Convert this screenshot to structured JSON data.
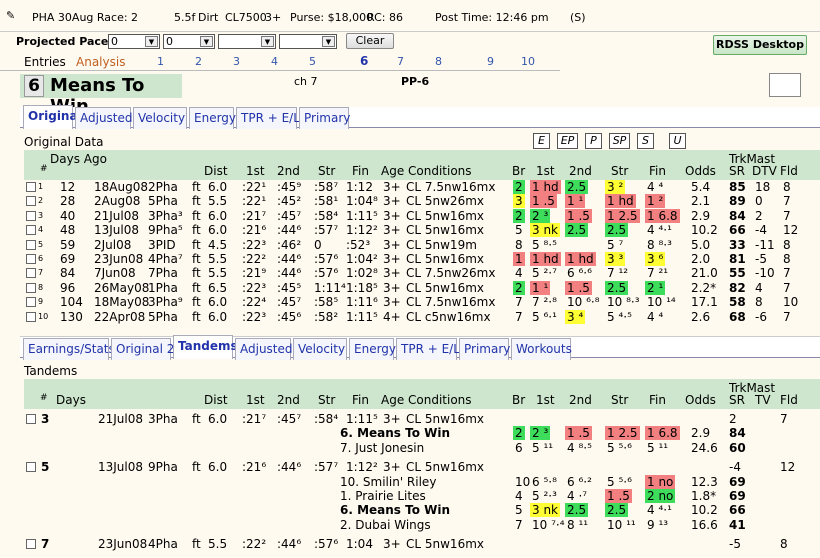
{
  "header": {
    "race": "PHA 30Aug Race: 2",
    "dist": "5.5f",
    "surface": "Dirt",
    "class": "CL7500",
    "flag": "3+",
    "purse": "Purse: $18,000",
    "rc": "RC: 86",
    "post": "Post Time: 12:46 pm",
    "s": "(S)"
  },
  "pace": {
    "label": "Projected Pace:",
    "v1": "0",
    "v2": "0",
    "v3": "",
    "v4": "",
    "clear": "Clear",
    "rdss": "RDSS Desktop"
  },
  "top_tabs": {
    "entries": "Entries",
    "analysis": "Analysis",
    "nums": [
      "1",
      "2",
      "3",
      "4",
      "5",
      "6",
      "7",
      "8",
      "9",
      "10"
    ]
  },
  "horse": {
    "num": "6",
    "name": "Means To Win",
    "sex": "ch 7",
    "pp": "PP-6"
  },
  "tabs_a": [
    "Original",
    "Adjusted",
    "Velocity",
    "Energy",
    "TPR + E/L",
    "Primary"
  ],
  "section_a": "Original Data",
  "view_buttons": [
    "E",
    "EP",
    "P",
    "SP",
    "S",
    "U"
  ],
  "hdr_a": {
    "days_ago": "Days Ago",
    "num": "#",
    "dist": "Dist",
    "c1": "1st",
    "c2": "2nd",
    "str": "Str",
    "fin": "Fin",
    "age": "Age",
    "cond": "Conditions",
    "br": "Br",
    "b1": "1st",
    "b2": "2nd",
    "bs": "Str",
    "bf": "Fin",
    "odds": "Odds",
    "trk": "TrkMast",
    "sr": "SR",
    "dtv": "DTV",
    "fld": "Fld"
  },
  "rows_a": [
    {
      "n": "1",
      "days": "12",
      "date": "18Aug08",
      "trk": "2Pha",
      "s": "ft",
      "dist": "6.0",
      "f1": ":22¹",
      "f2": ":45⁹",
      "fs": ":58⁷",
      "ff": "1:12",
      "age": "3+",
      "cond": "CL 7.5nw16mx",
      "br": "2",
      "p1": "1 hd",
      "p2": "2.5",
      "ps": "3 ²",
      "pf": "4 ⁴",
      "odds": "5.4",
      "sr": "85",
      "dtv": "18",
      "fld": "8"
    },
    {
      "n": "2",
      "days": "28",
      "date": "2Aug08",
      "trk": "5Pha",
      "s": "ft",
      "dist": "5.5",
      "f1": ":22¹",
      "f2": ":45²",
      "fs": ":58¹",
      "ff": "1:04⁸",
      "age": "3+",
      "cond": "CL 5nw26mx",
      "br": "3",
      "p1": "1 .5",
      "p2": "1 ¹",
      "ps": "1 hd",
      "pf": "1 ²",
      "odds": "2.1",
      "sr": "89",
      "dtv": "0",
      "fld": "7"
    },
    {
      "n": "3",
      "days": "40",
      "date": "21Jul08",
      "trk": "3Pha³",
      "s": "ft",
      "dist": "6.0",
      "f1": ":21⁷",
      "f2": ":45⁷",
      "fs": ":58⁴",
      "ff": "1:11⁵",
      "age": "3+",
      "cond": "CL 5nw16mx",
      "br": "2",
      "p1": "2 ³",
      "p2": "1 .5",
      "ps": "1 2.5",
      "pf": "1 6.8",
      "odds": "2.9",
      "sr": "84",
      "dtv": "2",
      "fld": "7"
    },
    {
      "n": "4",
      "days": "48",
      "date": "13Jul08",
      "trk": "9Pha⁵",
      "s": "ft",
      "dist": "6.0",
      "f1": ":21⁶",
      "f2": ":44⁶",
      "fs": ":57⁷",
      "ff": "1:12²",
      "age": "3+",
      "cond": "CL 5nw16mx",
      "br": "5",
      "p1": "3 nk",
      "p2": "2.5",
      "ps": "2.5",
      "pf": "4 ⁴·¹",
      "odds": "10.2",
      "sr": "66",
      "dtv": "-4",
      "fld": "12"
    },
    {
      "n": "5",
      "days": "59",
      "date": "2Jul08",
      "trk": "3PID",
      "s": "ft",
      "dist": "4.5",
      "f1": ":22³",
      "f2": ":46²",
      "fs": "0",
      "ff": ":52³",
      "age": "3+",
      "cond": "CL 5nw19m",
      "br": "8",
      "p1": "5 ⁸·⁵",
      "p2": "",
      "ps": "5 ⁷",
      "pf": "8 ⁸·³",
      "odds": "5.0",
      "sr": "33",
      "dtv": "-11",
      "fld": "8"
    },
    {
      "n": "6",
      "days": "69",
      "date": "23Jun08",
      "trk": "4Pha⁷",
      "s": "ft",
      "dist": "5.5",
      "f1": ":22²",
      "f2": ":44⁶",
      "fs": ":57⁶",
      "ff": "1:04²",
      "age": "3+",
      "cond": "CL 5nw16mx",
      "br": "1",
      "p1": "1 hd",
      "p2": "1 hd",
      "ps": "3 ³",
      "pf": "3 ⁶",
      "odds": "2.0",
      "sr": "81",
      "dtv": "-5",
      "fld": "8"
    },
    {
      "n": "7",
      "days": "84",
      "date": "7Jun08",
      "trk": "7Pha",
      "s": "ft",
      "dist": "5.5",
      "f1": ":21⁹",
      "f2": ":44⁶",
      "fs": ":57⁶",
      "ff": "1:02⁸",
      "age": "3+",
      "cond": "CL 7.5nw26mx",
      "br": "4",
      "p1": "5 ²·⁷",
      "p2": "6 ⁶·⁶",
      "ps": "7 ¹²",
      "pf": "7 ²¹",
      "odds": "21.0",
      "sr": "55",
      "dtv": "-10",
      "fld": "7"
    },
    {
      "n": "8",
      "days": "96",
      "date": "26May08",
      "trk": "1Pha",
      "s": "ft",
      "dist": "6.5",
      "f1": ":22³",
      "f2": ":45⁵",
      "fs": "1:11⁴",
      "ff": "1:18⁵",
      "age": "3+",
      "cond": "CL 5nw16mx",
      "br": "2",
      "p1": "1 ¹",
      "p2": "1 .5",
      "ps": "2.5",
      "pf": "2 ¹",
      "odds": "2.2*",
      "sr": "82",
      "dtv": "4",
      "fld": "7"
    },
    {
      "n": "9",
      "days": "104",
      "date": "18May08",
      "trk": "3Pha⁹",
      "s": "ft",
      "dist": "6.0",
      "f1": ":22⁴",
      "f2": ":45⁷",
      "fs": ":58⁵",
      "ff": "1:11⁶",
      "age": "3+",
      "cond": "CL 7.5nw16mx",
      "br": "7",
      "p1": "7 ²·⁸",
      "p2": "10 ⁶·⁸",
      "ps": "10 ⁸·³",
      "pf": "10 ¹⁴",
      "odds": "17.1",
      "sr": "58",
      "dtv": "8",
      "fld": "10"
    },
    {
      "n": "10",
      "days": "130",
      "date": "22Apr08",
      "trk": "5Pha",
      "s": "ft",
      "dist": "6.0",
      "f1": ":22³",
      "f2": ":45⁶",
      "fs": ":58²",
      "ff": "1:11⁵",
      "age": "4+",
      "cond": "CL c5nw16mx",
      "br": "7",
      "p1": "5 ⁶·¹",
      "p2": "3 ⁴",
      "ps": "5 ⁴·⁵",
      "pf": "4 ⁴",
      "odds": "2.6",
      "sr": "68",
      "dtv": "-6",
      "fld": "7"
    }
  ],
  "tabs_b": [
    "Earnings/Stats",
    "Original 2",
    "Tandems",
    "Adjusted",
    "Velocity",
    "Energy",
    "TPR + E/L",
    "Primary",
    "Workouts"
  ],
  "section_b": "Tandems",
  "hdr_b": {
    "num": "#",
    "days": "Days",
    "dist": "Dist",
    "c1": "1st",
    "c2": "2nd",
    "str": "Str",
    "fin": "Fin",
    "age": "Age",
    "cond": "Conditions",
    "br": "Br",
    "b1": "1st",
    "b2": "2nd",
    "bs": "Str",
    "bf": "Fin",
    "odds": "Odds",
    "trk": "TrkMast",
    "sr": "SR",
    "tv": "TV",
    "fld": "Fld"
  },
  "tandems": [
    {
      "n": "3",
      "date": "21Jul08",
      "trk": "3Pha",
      "s": "ft",
      "dist": "6.0",
      "f1": ":21⁷",
      "f2": ":45⁷",
      "fs": ":58⁴",
      "ff": "1:11⁵",
      "age": "3+",
      "cond": "CL 5nw16mx",
      "sr": "2",
      "tv": "7",
      "horses": [
        {
          "h": "6.  Means To Win",
          "bold": true,
          "br": "2",
          "p1": "2 ³",
          "p2": "1 .5",
          "ps": "1 2.5",
          "pf": "1 6.8",
          "odds": "2.9",
          "sr": "84"
        },
        {
          "h": "7.  Just Jonesin",
          "bold": false,
          "br": "6",
          "p1": "5 ¹¹",
          "p2": "4 ⁸·⁵",
          "ps": "5 ⁵·⁶",
          "pf": "5 ¹¹",
          "odds": "24.6",
          "sr": "60"
        }
      ]
    },
    {
      "n": "5",
      "date": "13Jul08",
      "trk": "9Pha",
      "s": "ft",
      "dist": "6.0",
      "f1": ":21⁶",
      "f2": ":44⁶",
      "fs": ":57⁷",
      "ff": "1:12²",
      "age": "3+",
      "cond": "CL 5nw16mx",
      "sr": "-4",
      "tv": "12",
      "horses": [
        {
          "h": "10.  Smilin' Riley",
          "bold": false,
          "br": "10",
          "p1": "6 ⁵·⁸",
          "p2": "6 ⁶·²",
          "ps": "5 ⁵·⁶",
          "pf": "1 no",
          "odds": "12.3",
          "sr": "69"
        },
        {
          "h": "1.  Prairie Lites",
          "bold": false,
          "br": "4",
          "p1": "5 ²·³",
          "p2": "4 ·⁷",
          "ps": "1 .5",
          "pf": "2 no",
          "odds": "1.8*",
          "sr": "69"
        },
        {
          "h": "6.  Means To Win",
          "bold": true,
          "br": "5",
          "p1": "3 nk",
          "p2": "2.5",
          "ps": "2.5",
          "pf": "4 ⁴·¹",
          "odds": "10.2",
          "sr": "66"
        },
        {
          "h": "2.  Dubai Wings",
          "bold": false,
          "br": "7",
          "p1": "10 ⁷·⁴",
          "p2": "8 ¹¹",
          "ps": "10 ¹¹",
          "pf": "9 ¹³",
          "odds": "16.6",
          "sr": "41"
        }
      ]
    },
    {
      "n": "7",
      "date": "23Jun08",
      "trk": "4Pha",
      "s": "ft",
      "dist": "5.5",
      "f1": ":22²",
      "f2": ":44⁶",
      "fs": ":57⁶",
      "ff": "1:04",
      "age": "3+",
      "cond": "CL 5nw16mx",
      "sr": "-5",
      "tv": "8",
      "horses": []
    }
  ],
  "colors": {
    "green": "#3ddc5a",
    "red": "#f28080",
    "yellow": "#ffff33",
    "header_green": "#cde6cd"
  }
}
